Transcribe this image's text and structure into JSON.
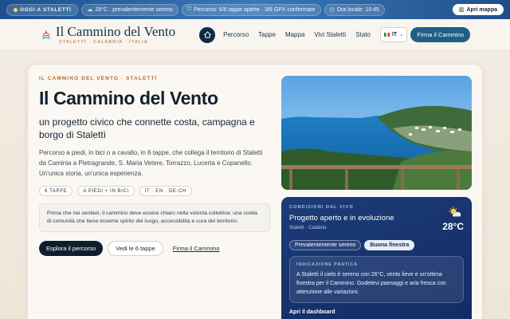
{
  "topbar": {
    "live_label": "OGGI A STALETTÌ",
    "weather": "28°C · prevalentemente sereno",
    "route": "Percorso: 6/6 tappe aperte · 3/6 GPX confermate",
    "time": "Ora locale: 10:45",
    "map_button": "Apri mappa"
  },
  "header": {
    "brand_title": "Il Cammino del Vento",
    "brand_sub": "STALETTÌ · CALABRIA · ITALIA",
    "nav": [
      "Percorso",
      "Tappe",
      "Mappa",
      "Vivi Stalettì",
      "Stato"
    ],
    "lang": "IT",
    "sign_button": "Firma il Cammino"
  },
  "hero": {
    "eyebrow": "IL CAMMINO DEL VENTO · STALETTÌ",
    "title": "Il Cammino del Vento",
    "subtitle": "un progetto civico che connette costa, campagna e borgo di Stalettì",
    "description": "Percorso a piedi, in bici o a cavallo, in 6 tappe, che collega il territorio di Stalettì da Caminia a Pietragrande, S. Maria Vetere, Torrazzo, Lucerta e Copanello. Un'unica storia, un'unica esperienza.",
    "tags": [
      "6 TAPPE",
      "A PIEDI + IN BICI",
      "IT · EN · DE-CH"
    ],
    "quote": "Prima che nei sentieri, il cammino deve essere chiaro nella volontà collettiva: una scelta di comunità che tiene insieme spirito del luogo, accessibilità e cura del territorio.",
    "primary_button": "Esplora il percorso",
    "secondary_button": "Vedi le 6 tappe",
    "link": "Firma il Cammino"
  },
  "conditions": {
    "eyebrow": "CONDIZIONI DAL VIVO",
    "title": "Progetto aperto e in evoluzione",
    "location": "Stalettì · Calabria",
    "temperature": "28°C",
    "chips": [
      "Prevalentemente sereno",
      "Buona finestra"
    ],
    "tip_eyebrow": "INDICAZIONE PRATICA",
    "tip_text": "A Stalettì il cielo è sereno con 26°C, vento lieve e un'ottima finestra per il Cammino. Godetevi paesaggi e aria fresca con attenzione alle variazioni.",
    "link": "Apri il dashboard"
  },
  "colors": {
    "topbar": "#2b62a3",
    "accent": "#1e5f86",
    "panel": "#1a3a74",
    "eyebrow": "#b36a2f"
  }
}
